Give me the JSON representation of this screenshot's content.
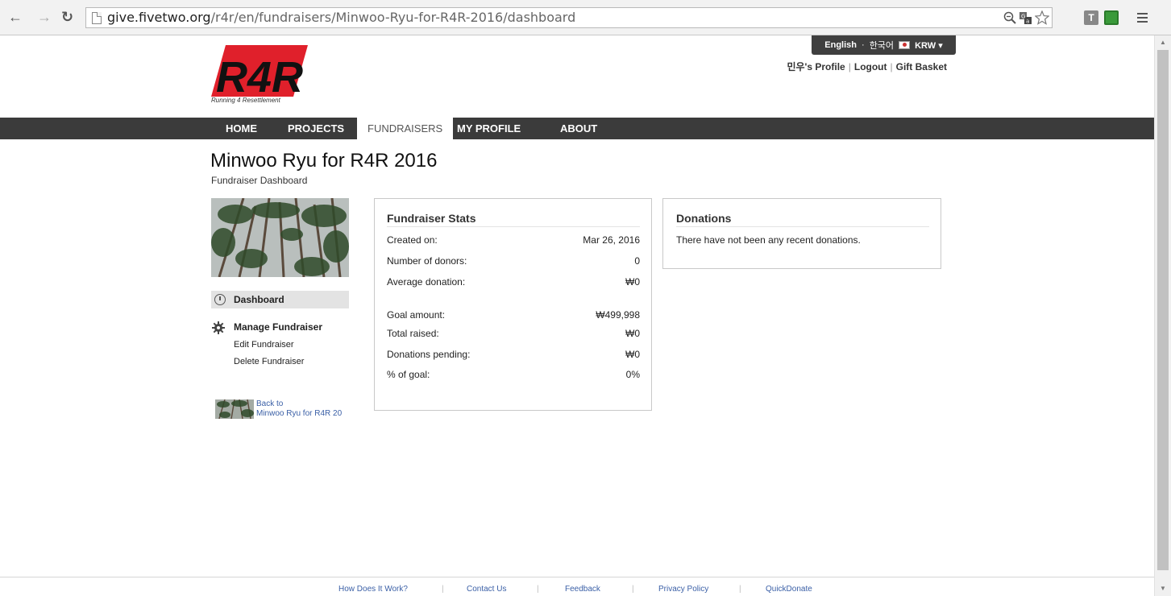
{
  "browser": {
    "url_host": "give.fivetwo.org",
    "url_path": "/r4r/en/fundraisers/Minwoo-Ryu-for-R4R-2016/dashboard",
    "ext_t": "T"
  },
  "header": {
    "lang_english": "English",
    "lang_korean": "한국어",
    "currency": "KRW",
    "profile_link": "민우's Profile",
    "logout_link": "Logout",
    "basket_link": "Gift Basket",
    "logo_text": "R4R",
    "logo_tagline": "Running 4 Resettlement"
  },
  "nav": {
    "home": "HOME",
    "projects": "PROJECTS",
    "fundraisers": "FUNDRAISERS",
    "my_profile": "MY PROFILE",
    "about": "ABOUT"
  },
  "page": {
    "title": "Minwoo Ryu for R4R 2016",
    "subtitle": "Fundraiser Dashboard"
  },
  "sidebar": {
    "dashboard": "Dashboard",
    "manage": "Manage Fundraiser",
    "edit": "Edit Fundraiser",
    "delete": "Delete Fundraiser",
    "back_line1": "Back to",
    "back_line2": "Minwoo Ryu for R4R 20"
  },
  "stats": {
    "heading": "Fundraiser Stats",
    "rows": [
      {
        "label": "Created on:",
        "value": "Mar 26, 2016"
      },
      {
        "label": "Number of donors:",
        "value": "0"
      },
      {
        "label": "Average donation:",
        "value": "₩0"
      },
      {
        "label": "Goal amount:",
        "value": "₩499,998"
      },
      {
        "label": "Total raised:",
        "value": "₩0"
      },
      {
        "label": "Donations pending:",
        "value": "₩0"
      },
      {
        "label": "% of goal:",
        "value": "0%"
      }
    ]
  },
  "donations": {
    "heading": "Donations",
    "empty_text": "There have not been any recent donations."
  },
  "footer": {
    "how": "How Does It Work?",
    "contact": "Contact Us",
    "feedback": "Feedback",
    "privacy": "Privacy Policy",
    "quickdonate": "QuickDonate",
    "separator": "|"
  },
  "colors": {
    "nav_bg": "#3b3b3b",
    "link_blue": "#3a5fa6",
    "logo_red": "#e0202b"
  }
}
